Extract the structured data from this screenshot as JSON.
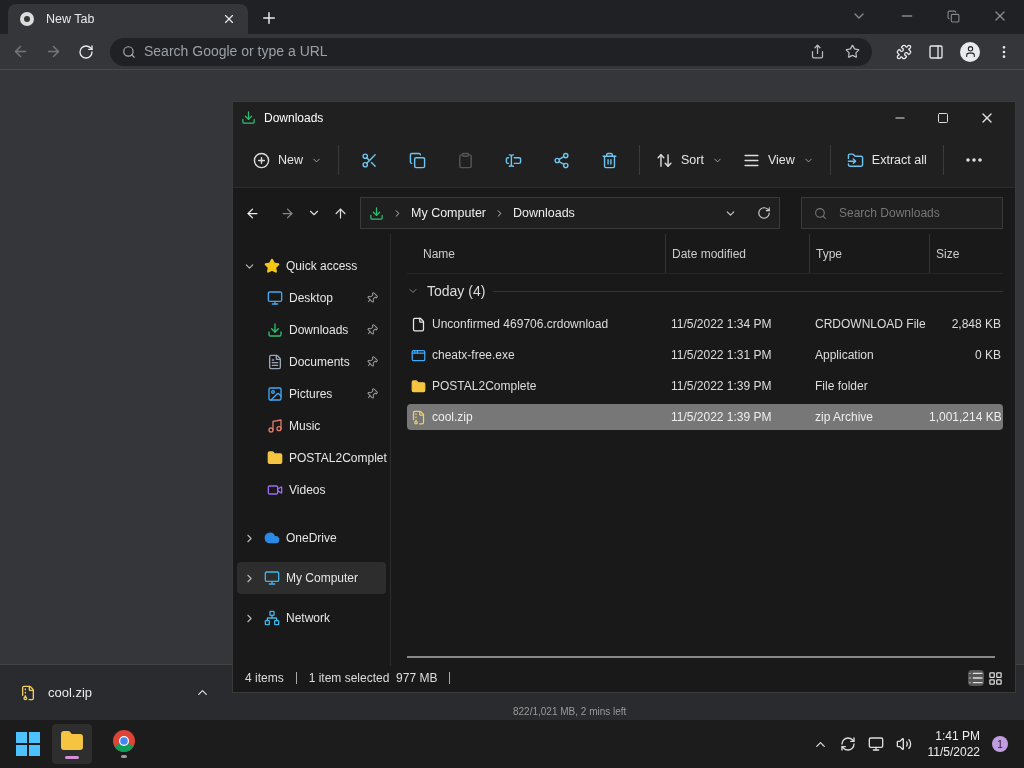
{
  "browser": {
    "tab": {
      "title": "New Tab"
    },
    "omnibox": {
      "placeholder": "Search Google or type a URL"
    },
    "download_shelf": {
      "items": [
        {
          "name": "cool.zip"
        }
      ],
      "behind_status": "822/1,021 MB, 2 mins left"
    }
  },
  "explorer": {
    "title": "Downloads",
    "toolbar": [
      {
        "kind": "new",
        "label": "New"
      },
      {
        "kind": "cut"
      },
      {
        "kind": "copy"
      },
      {
        "kind": "paste",
        "disabled": true
      },
      {
        "kind": "rename"
      },
      {
        "kind": "share"
      },
      {
        "kind": "delete"
      },
      {
        "kind": "sort",
        "label": "Sort"
      },
      {
        "kind": "view",
        "label": "View"
      },
      {
        "kind": "extract",
        "label": "Extract all"
      },
      {
        "kind": "more"
      }
    ],
    "breadcrumb": [
      "My Computer",
      "Downloads"
    ],
    "search": {
      "placeholder": "Search Downloads"
    },
    "nav": [
      {
        "kind": "star",
        "label": "Quick access",
        "expanded": true,
        "selected": false,
        "children": [
          {
            "kind": "desktop",
            "label": "Desktop",
            "pinned": true
          },
          {
            "kind": "download",
            "label": "Downloads",
            "pinned": true
          },
          {
            "kind": "document",
            "label": "Documents",
            "pinned": true
          },
          {
            "kind": "pictures",
            "label": "Pictures",
            "pinned": true
          },
          {
            "kind": "music",
            "label": "Music",
            "pinned": false
          },
          {
            "kind": "folder",
            "label": "POSTAL2Complet",
            "pinned": false
          },
          {
            "kind": "videos",
            "label": "Videos",
            "pinned": false
          }
        ]
      },
      {
        "kind": "cloud",
        "label": "OneDrive",
        "expanded": false,
        "selected": false
      },
      {
        "kind": "computer",
        "label": "My Computer",
        "expanded": false,
        "selected": true
      },
      {
        "kind": "network",
        "label": "Network",
        "expanded": false,
        "selected": false
      }
    ],
    "columns": [
      "Name",
      "Date modified",
      "Type",
      "Size"
    ],
    "group": {
      "label": "Today (4)",
      "expanded": true
    },
    "rows": [
      {
        "kind": "file",
        "name": "Unconfirmed 469706.crdownload",
        "date": "11/5/2022 1:34 PM",
        "type": "CRDOWNLOAD File",
        "size": "2,848 KB",
        "selected": false
      },
      {
        "kind": "app",
        "name": "cheatx-free.exe",
        "date": "11/5/2022 1:31 PM",
        "type": "Application",
        "size": "0 KB",
        "selected": false
      },
      {
        "kind": "folder",
        "name": "POSTAL2Complete",
        "date": "11/5/2022 1:39 PM",
        "type": "File folder",
        "selected": false
      },
      {
        "kind": "zip",
        "name": "cool.zip",
        "date": "11/5/2022 1:39 PM",
        "type": "zip Archive",
        "size": "1,001,214 KB",
        "selected": true
      }
    ],
    "status": {
      "count": "4 items",
      "selection": "1 item selected  977 MB"
    }
  },
  "taskbar": {
    "apps": [
      {
        "kind": "explorer",
        "active": true
      },
      {
        "kind": "chrome",
        "active": false
      }
    ],
    "time": "1:41 PM",
    "date": "11/5/2022",
    "badge": "1"
  }
}
